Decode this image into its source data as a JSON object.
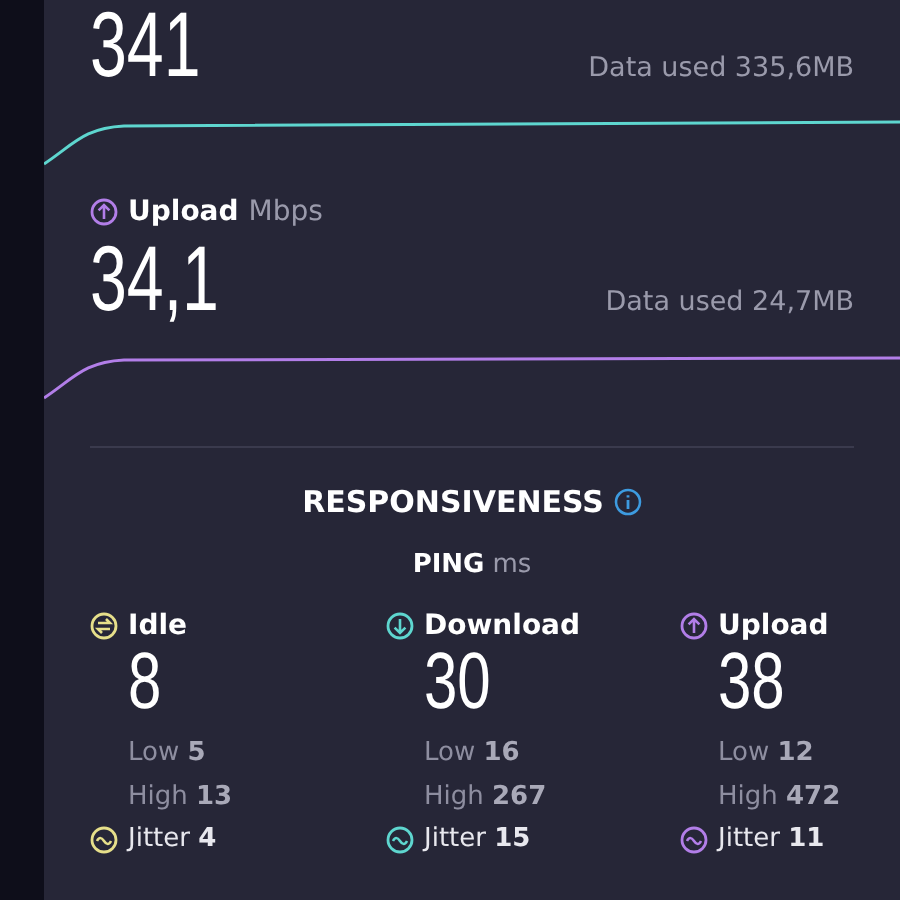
{
  "download": {
    "value": "341",
    "data_used": "Data used 335,6MB"
  },
  "upload": {
    "label": "Upload",
    "unit": "Mbps",
    "value": "34,1",
    "data_used": "Data used 24,7MB"
  },
  "responsiveness": {
    "title": "RESPONSIVENESS",
    "ping_label": "PING",
    "ping_unit": "ms",
    "columns": [
      {
        "kind": "idle",
        "label": "Idle",
        "value": "8",
        "low": "Low **5**",
        "high": "High **13**",
        "jitter": "Jitter **4**"
      },
      {
        "kind": "download",
        "label": "Download",
        "value": "30",
        "low": "Low **16**",
        "high": "High **267**",
        "jitter": "Jitter **15**"
      },
      {
        "kind": "upload",
        "label": "Upload",
        "value": "38",
        "low": "Low **12**",
        "high": "High **472**",
        "jitter": "Jitter **11**"
      }
    ]
  }
}
